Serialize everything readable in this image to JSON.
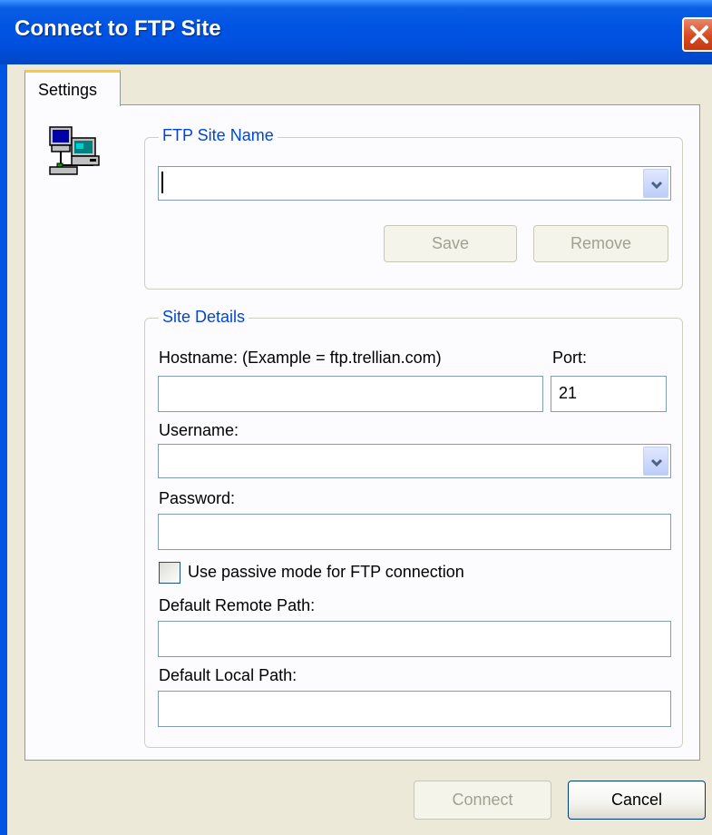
{
  "window": {
    "title": "Connect to FTP Site"
  },
  "tabs": [
    {
      "label": "Settings",
      "selected": true
    }
  ],
  "site_name_group": {
    "legend": "FTP Site Name",
    "site_combo_value": "",
    "save_label": "Save",
    "remove_label": "Remove"
  },
  "site_details_group": {
    "legend": "Site Details",
    "hostname_label": "Hostname: (Example = ftp.trellian.com)",
    "hostname_value": "",
    "port_label": "Port:",
    "port_value": "21",
    "username_label": "Username:",
    "username_value": "",
    "password_label": "Password:",
    "password_value": "",
    "passive_mode_label": "Use passive mode for FTP connection",
    "passive_mode_checked": false,
    "remote_path_label": "Default Remote Path:",
    "remote_path_value": "",
    "local_path_label": "Default Local Path:",
    "local_path_value": ""
  },
  "footer": {
    "connect_label": "Connect",
    "connect_enabled": false,
    "cancel_label": "Cancel"
  },
  "icons": {
    "close": "close-icon",
    "site": "network-computers-icon",
    "dropdown": "chevron-down-icon"
  },
  "colors": {
    "titlebar": "#0054e3",
    "dialog_bg": "#ece9d8",
    "group_legend": "#0046d5",
    "close_button": "#d84920",
    "tab_highlight": "#ffc83c"
  }
}
